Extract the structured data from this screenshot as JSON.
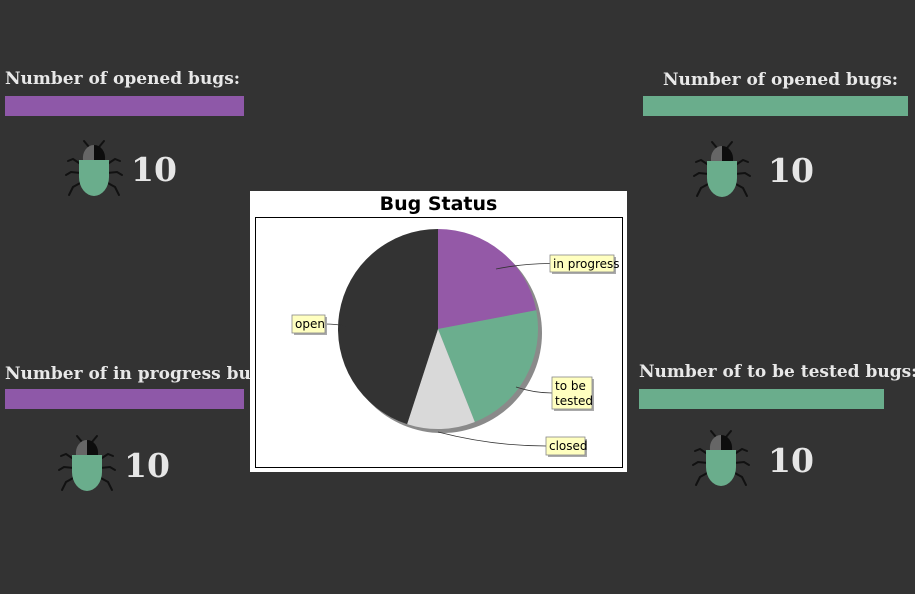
{
  "panels": [
    {
      "title": "Number of opened bugs:",
      "count": "10",
      "bar_color": "#8e58a8"
    },
    {
      "title": "Number of opened bugs:",
      "count": "10",
      "bar_color": "#6aad8c"
    },
    {
      "title": "Number of in progress bugs:",
      "count": "10",
      "bar_color": "#8e58a8"
    },
    {
      "title": "Number of to be tested bugs:",
      "count": "10",
      "bar_color": "#6aad8c"
    }
  ],
  "icon": "bug-icon",
  "chart_data": {
    "type": "pie",
    "title": "Bug Status",
    "slices": [
      {
        "label": "in progress",
        "value": 22,
        "color": "#9459a7"
      },
      {
        "label": "to be tested",
        "value": 22,
        "color": "#6bae8e"
      },
      {
        "label": "closed",
        "value": 11,
        "color": "#d9d9d9"
      },
      {
        "label": "open",
        "value": 45,
        "color": "#333333"
      }
    ]
  }
}
